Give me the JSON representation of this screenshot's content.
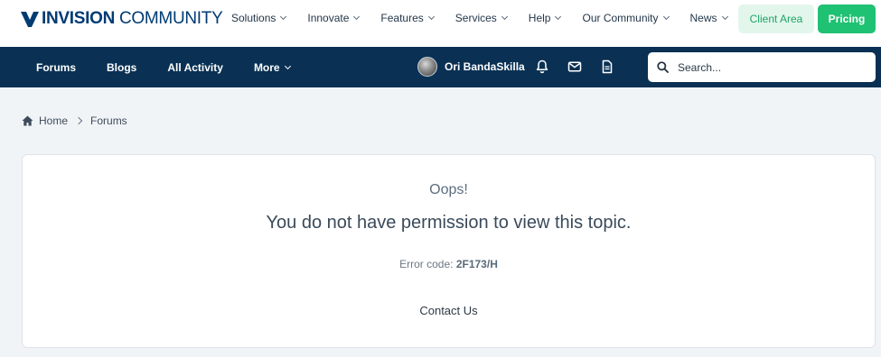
{
  "brand": {
    "name_bold": "INVISION",
    "name_rest": " COMMUNITY",
    "accent_color": "#003b73"
  },
  "main_nav": {
    "items": [
      {
        "label": "Solutions"
      },
      {
        "label": "Innovate"
      },
      {
        "label": "Features"
      },
      {
        "label": "Services"
      },
      {
        "label": "Help"
      },
      {
        "label": "Our Community"
      },
      {
        "label": "News"
      }
    ],
    "client_area_label": "Client Area",
    "pricing_label": "Pricing",
    "pricing_color": "#1fc173"
  },
  "community_nav": {
    "items": [
      {
        "label": "Forums"
      },
      {
        "label": "Blogs"
      },
      {
        "label": "All Activity"
      },
      {
        "label": "More"
      }
    ],
    "bar_color": "#0a3154"
  },
  "user": {
    "name": "Ori BandaSkilla",
    "icons": [
      "bell-icon",
      "envelope-icon",
      "document-icon"
    ]
  },
  "search": {
    "placeholder": "Search..."
  },
  "breadcrumb": {
    "home": "Home",
    "current": "Forums"
  },
  "error": {
    "title": "Oops!",
    "message": "You do not have permission to view this topic.",
    "code_label": "Error code: ",
    "code": "2F173/H",
    "contact_label": "Contact Us"
  }
}
